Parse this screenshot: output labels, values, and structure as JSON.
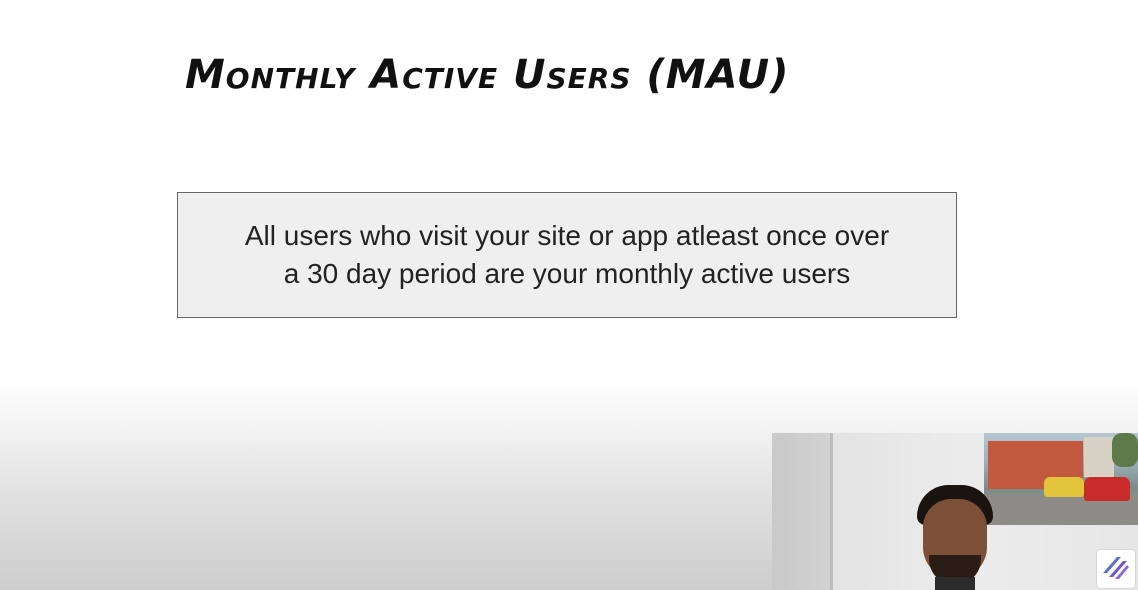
{
  "slide": {
    "title": "Monthly Active Users (MAU)",
    "definition_line1": "All users who visit your site or app atleast once over",
    "definition_line2": "a 30 day period are your monthly active users"
  },
  "overlay": {
    "webcam_icon": "presenter-webcam-feed",
    "logo_icon": "stripes-logo-icon"
  }
}
